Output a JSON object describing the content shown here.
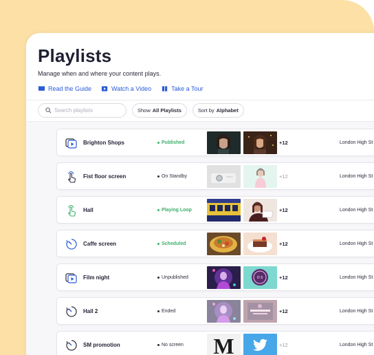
{
  "header": {
    "title": "Playlists",
    "subtitle": "Manage when and where your content plays.",
    "links": [
      {
        "label": "Read the Guide",
        "icon": "book-icon"
      },
      {
        "label": "Watch a Video",
        "icon": "video-icon"
      },
      {
        "label": "Take a Tour",
        "icon": "map-icon"
      }
    ]
  },
  "toolbar": {
    "search_placeholder": "Search playlists",
    "filter_prefix": "Show",
    "filter_value": "All Playlists",
    "sort_prefix": "Sort by",
    "sort_value": "Alphabet"
  },
  "colors": {
    "accent": "#2b5bd7",
    "background_blob": "#fde0a6",
    "status_green": "#3dae6b",
    "text_dark": "#1f2033"
  },
  "playlists": [
    {
      "name": "Brighton Shops",
      "icon": "playlist-media-icon",
      "status": "Published",
      "status_color": "#3dae6b",
      "status_dim": false,
      "thumbs": [
        "woman-portrait",
        "woman-sparkles"
      ],
      "more": "+12",
      "more_muted": false,
      "location": "London High St"
    },
    {
      "name": "Fist floor screen",
      "icon": "touch-hand-icon",
      "status": "On Standby",
      "status_color": "#2a2a3a",
      "status_dim": true,
      "thumbs": [
        "projector",
        "woman-mint"
      ],
      "more": "+12",
      "more_muted": true,
      "location": "London High St"
    },
    {
      "name": "Hall",
      "icon": "touch-hand-icon",
      "status": "Playing Loop",
      "status_color": "#3dae6b",
      "status_dim": false,
      "thumbs": [
        "train",
        "woman-reading"
      ],
      "more": "+12",
      "more_muted": false,
      "location": "London High St"
    },
    {
      "name": "Caffe screen",
      "icon": "clock-icon",
      "status": "Scheduled",
      "status_color": "#3dae6b",
      "status_dim": false,
      "thumbs": [
        "food-bowl",
        "dessert"
      ],
      "more": "+12",
      "more_muted": false,
      "location": "London High St"
    },
    {
      "name": "Film night",
      "icon": "playlist-media-icon",
      "status": "Unpublished",
      "status_color": "#2a2a3a",
      "status_dim": false,
      "thumbs": [
        "neon-portrait",
        "teal-badge"
      ],
      "more": "+12",
      "more_muted": false,
      "location": "London High St"
    },
    {
      "name": "Hall 2",
      "icon": "clock-icon",
      "status": "Ended",
      "status_color": "#2a2a3a",
      "status_dim": true,
      "thumbs": [
        "neon-portrait",
        "poster"
      ],
      "more": "+12",
      "more_muted": false,
      "location": "London High St"
    },
    {
      "name": "SM promotion",
      "icon": "clock-icon",
      "status": "No screen",
      "status_color": "#2a2a3a",
      "status_dim": false,
      "thumbs": [
        "medium-logo",
        "twitter-logo"
      ],
      "more": "+12",
      "more_muted": true,
      "location": "London High St"
    }
  ]
}
